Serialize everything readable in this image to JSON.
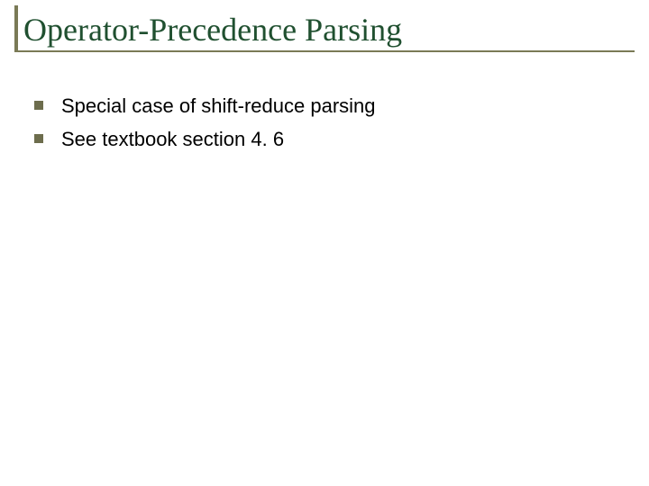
{
  "title": "Operator-Precedence Parsing",
  "bullets": [
    {
      "text": "Special case of shift-reduce parsing"
    },
    {
      "text": "See textbook section 4. 6"
    }
  ]
}
